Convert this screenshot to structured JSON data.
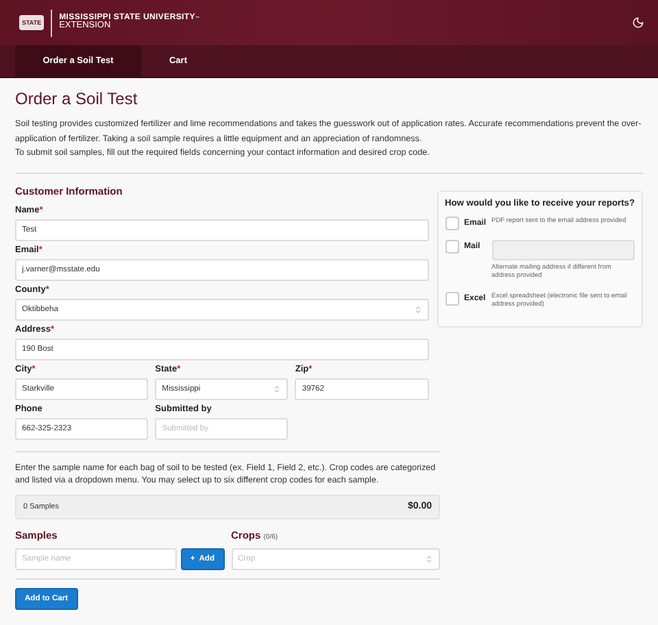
{
  "header": {
    "logo_badge": "STATE",
    "logo_line1": "MISSISSIPPI STATE UNIVERSITY",
    "logo_tm": "™",
    "logo_line2": "EXTENSION"
  },
  "tabs": [
    {
      "label": "Order a Soil Test",
      "selected": true
    },
    {
      "label": "Cart",
      "selected": false
    }
  ],
  "title": "Order a Soil Test",
  "intro": [
    "Soil testing provides customized fertilizer and lime recommendations and takes the guesswork out of application rates. Accurate recommendations prevent the over-application of fertilizer. Taking a soil sample requires a little equipment and an appreciation of randomness.",
    "To submit soil samples, fill out the required fields concerning your contact information and desired crop code."
  ],
  "customer": {
    "heading": "Customer Information",
    "rows": [
      [
        {
          "label": "Name",
          "mark": "*",
          "kind": "text",
          "value": "Test"
        }
      ],
      [
        {
          "label": "Email",
          "mark": "*",
          "kind": "text",
          "value": "j.varner@msstate.edu"
        }
      ],
      [
        {
          "label": "County",
          "mark": "*",
          "kind": "select",
          "value": "Oktibbeha"
        }
      ],
      [
        {
          "label": "Address",
          "mark": "*",
          "kind": "text",
          "value": "190 Bost"
        }
      ],
      [
        {
          "label": "City",
          "mark": "*",
          "kind": "text",
          "value": "Starkville"
        },
        {
          "label": "State",
          "mark": "*",
          "kind": "select",
          "value": "Mississippi"
        },
        {
          "label": "Zip",
          "mark": "*",
          "kind": "text",
          "value": "39762"
        }
      ],
      [
        {
          "label": "Phone",
          "kind": "text",
          "value": "662-325-2323"
        },
        {
          "label": "Submitted by",
          "kind": "text",
          "placeholder": "Submitted by"
        }
      ]
    ]
  },
  "reports": {
    "heading": "How would you like to receive your reports?",
    "options": [
      {
        "label": "Email",
        "checked": false,
        "kind": "note",
        "note": "PDF report sent to the email address provided"
      },
      {
        "label": "Mail",
        "checked": false,
        "kind": "address",
        "note": "Alternate mailing address if different from address provided"
      },
      {
        "label": "Excel",
        "checked": false,
        "kind": "note",
        "note": "Excel spreadsheet (electronic file sent to email address provided)"
      }
    ]
  },
  "samples_help": "Enter the sample name for each bag of soil to be tested (ex. Field 1, Field 2, etc.). Crop codes are categorized and listed via a dropdown menu. You may select up to six different crop codes for each sample.",
  "summary": {
    "count": "0 Samples",
    "total": "$0.00"
  },
  "samples": {
    "heading": "Samples",
    "placeholder": "Sample name",
    "add_icon": "+",
    "add_label": "Add"
  },
  "crops": {
    "heading": "Crops",
    "count": "(0/6)",
    "placeholder": "Crop"
  },
  "submit": "Add to Cart"
}
